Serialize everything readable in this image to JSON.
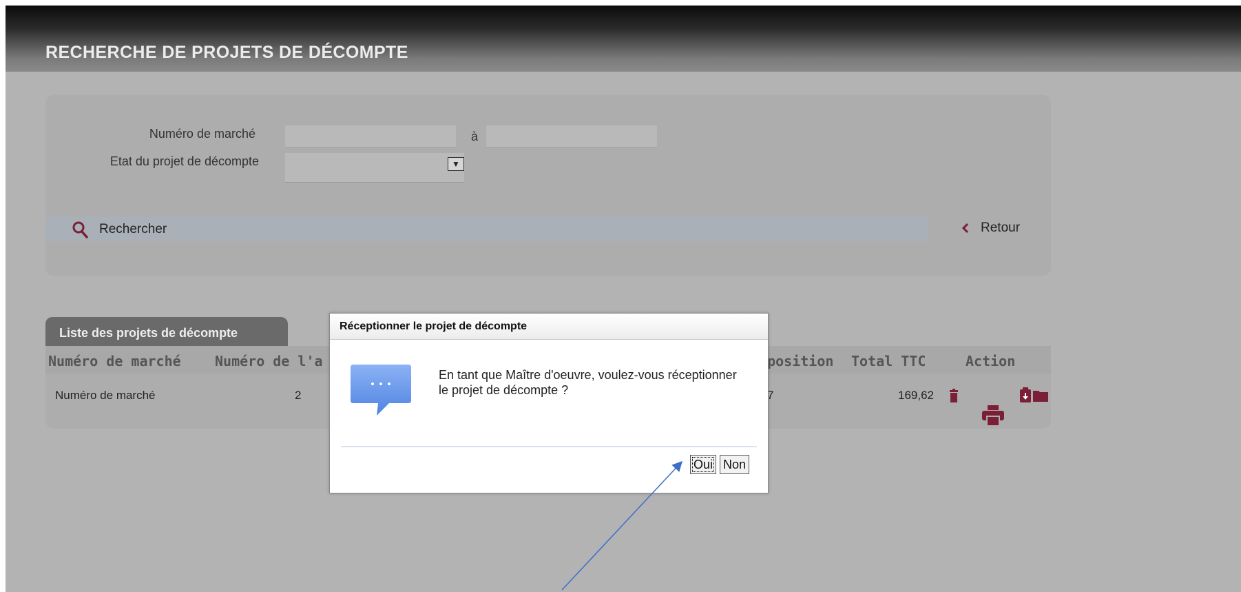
{
  "page": {
    "title": "RECHERCHE DE PROJETS DE DÉCOMPTE"
  },
  "search": {
    "numero_marche_label": "Numéro de marché",
    "numero_marche_from": "",
    "a_label": "à",
    "numero_marche_to": "",
    "etat_label": "Etat du projet de décompte",
    "etat_value": "",
    "search_button": "Rechercher",
    "back_button": "Retour"
  },
  "results": {
    "tab_label": "Liste des projets de décompte",
    "columns": [
      "Numéro de marché",
      "Numéro de l'a",
      "isposition",
      "Total TTC",
      "Action"
    ],
    "rows": [
      {
        "numero_marche": "Numéro de marché",
        "numero": "2",
        "disposition": "7",
        "total_ttc": "169,62"
      }
    ]
  },
  "dialog": {
    "title": "Réceptionner le projet de décompte",
    "message": "En tant que Maître d'oeuvre, voulez-vous réceptionner le projet de décompte ?",
    "yes_label": "Oui",
    "no_label": "Non"
  },
  "colors": {
    "accent": "#7a1f35",
    "dialog_icon": "#5b8fe8"
  },
  "icons": [
    "search-icon",
    "chevron-left-icon",
    "chevron-down-icon",
    "trash-icon",
    "printer-icon",
    "clipboard-icon",
    "folder-icon",
    "speech-bubble-icon"
  ]
}
